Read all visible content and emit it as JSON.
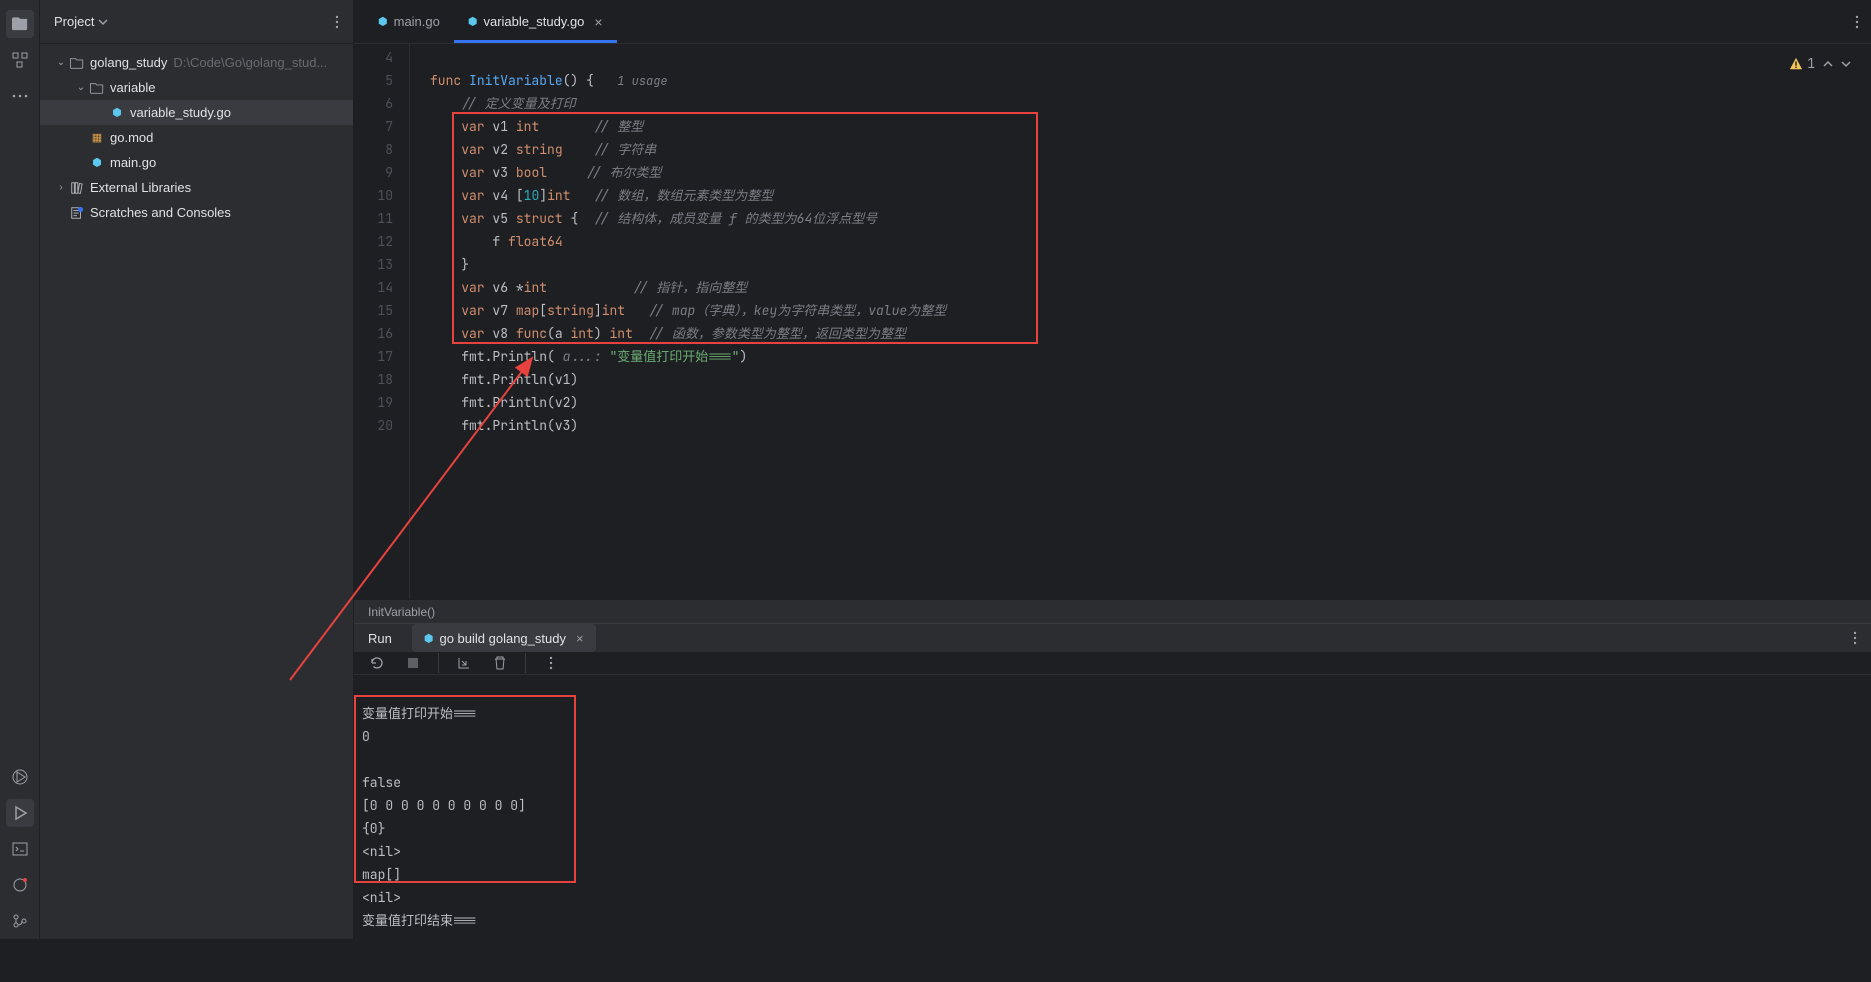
{
  "project": {
    "header": "Project",
    "root": {
      "name": "golang_study",
      "path": "D:\\Code\\Go\\golang_stud..."
    },
    "variable_folder": "variable",
    "variable_file": "variable_study.go",
    "go_mod": "go.mod",
    "main_go": "main.go",
    "ext_lib": "External Libraries",
    "scratches": "Scratches and Consoles"
  },
  "tabs": {
    "main": "main.go",
    "variable": "variable_study.go"
  },
  "warnings": {
    "count": "1"
  },
  "gutter": [
    "4",
    "5",
    "6",
    "7",
    "8",
    "9",
    "10",
    "11",
    "12",
    "13",
    "14",
    "15",
    "16",
    "17",
    "18",
    "19",
    "20"
  ],
  "code": {
    "l5": {
      "func_kw": "func",
      "name": "InitVariable",
      "paren_brace": "() {",
      "usage": "1 usage"
    },
    "l6": {
      "comment": "// 定义变量及打印"
    },
    "l7": {
      "var": "var",
      "id": "v1",
      "type": "int",
      "comment": "// 整型"
    },
    "l8": {
      "var": "var",
      "id": "v2",
      "type": "string",
      "comment": "// 字符串"
    },
    "l9": {
      "var": "var",
      "id": "v3",
      "type": "bool",
      "comment": "// 布尔类型"
    },
    "l10": {
      "var": "var",
      "id": "v4",
      "open": "[",
      "size": "10",
      "close": "]",
      "type": "int",
      "comment": "// 数组，数组元素类型为整型"
    },
    "l11": {
      "var": "var",
      "id": "v5",
      "struct_kw": "struct",
      "brace": " {",
      "comment": "// 结构体，成员变量 f 的类型为64位浮点型号"
    },
    "l12": {
      "f": "f",
      "type": "float64"
    },
    "l13": {
      "brace": "}"
    },
    "l14": {
      "var": "var",
      "id": "v6",
      "star": "*",
      "type": "int",
      "comment": "// 指针，指向整型"
    },
    "l15": {
      "var": "var",
      "id": "v7",
      "map_kw": "map",
      "open": "[",
      "ktype": "string",
      "close": "]",
      "vtype": "int",
      "comment": "// map（字典），key为字符串类型，value为整型"
    },
    "l16": {
      "var": "var",
      "id": "v8",
      "func_kw": "func",
      "open": "(a ",
      "ptype": "int",
      "close": ") ",
      "rtype": "int",
      "comment": "// 函数，参数类型为整型，返回类型为整型"
    },
    "l17": {
      "fmt": "fmt",
      "dot": ".",
      "fn": "Println",
      "open": "(",
      "hint": " a...: ",
      "str": "\"变量值打印开始===\"",
      "close": ")"
    },
    "l18": {
      "fmt": "fmt",
      "dot": ".",
      "fn": "Println",
      "arg": "(v1)"
    },
    "l19": {
      "fmt": "fmt",
      "dot": ".",
      "fn": "Println",
      "arg": "(v2)"
    },
    "l20": {
      "fmt": "fmt",
      "dot": ".",
      "fn": "Println",
      "arg": "(v3)"
    }
  },
  "breadcrumb": "InitVariable()",
  "run": {
    "label": "Run",
    "tab": "go build golang_study"
  },
  "console": {
    "l1": "变量值打印开始===",
    "l2": "0",
    "l3": "",
    "l4": "false",
    "l5": "[0 0 0 0 0 0 0 0 0 0]",
    "l6": "{0}",
    "l7": "<nil>",
    "l8": "map[]",
    "l9": "<nil>",
    "l10": "变量值打印结束==="
  }
}
